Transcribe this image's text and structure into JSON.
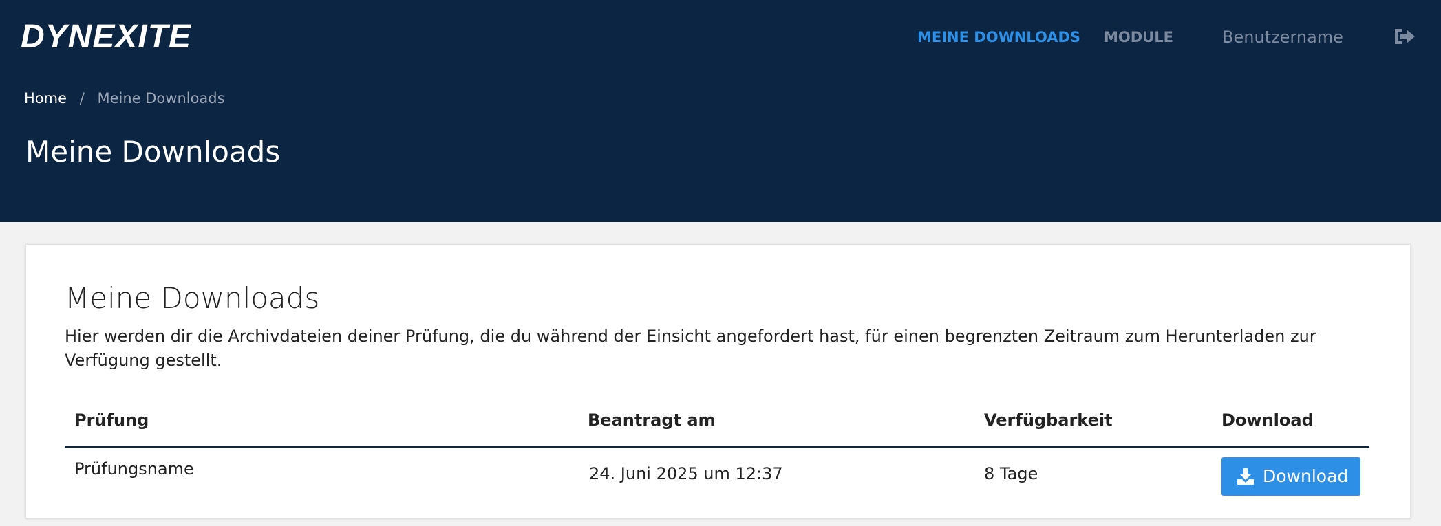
{
  "header": {
    "logo": "DYNEXITE",
    "nav": {
      "downloads": "MEINE DOWNLOADS",
      "module": "MODULE",
      "username": "Benutzername"
    },
    "logout_icon": "sign-out-icon",
    "breadcrumb": {
      "home": "Home",
      "separator": "/",
      "current": "Meine Downloads"
    },
    "page_title": "Meine Downloads"
  },
  "card": {
    "title": "Meine Downloads",
    "description": "Hier werden dir die Archivdateien deiner Prüfung, die du während der Einsicht angefordert hast, für einen begrenzten Zeitraum zum Herunterladen zur Verfügung gestellt."
  },
  "table": {
    "columns": [
      "Prüfung",
      "Beantragt am",
      "Verfügbarkeit",
      "Download"
    ],
    "rows": [
      {
        "exam": "Prüfungsname",
        "requested": "24. Juni 2025 um 12:37",
        "availability": "8 Tage",
        "download_label": "Download",
        "download_icon": "download-icon"
      }
    ]
  },
  "colors": {
    "header_bg": "#0b2542",
    "accent": "#2e8fe6",
    "nav_muted": "#7b8a9e",
    "page_bg": "#f2f2f2"
  }
}
